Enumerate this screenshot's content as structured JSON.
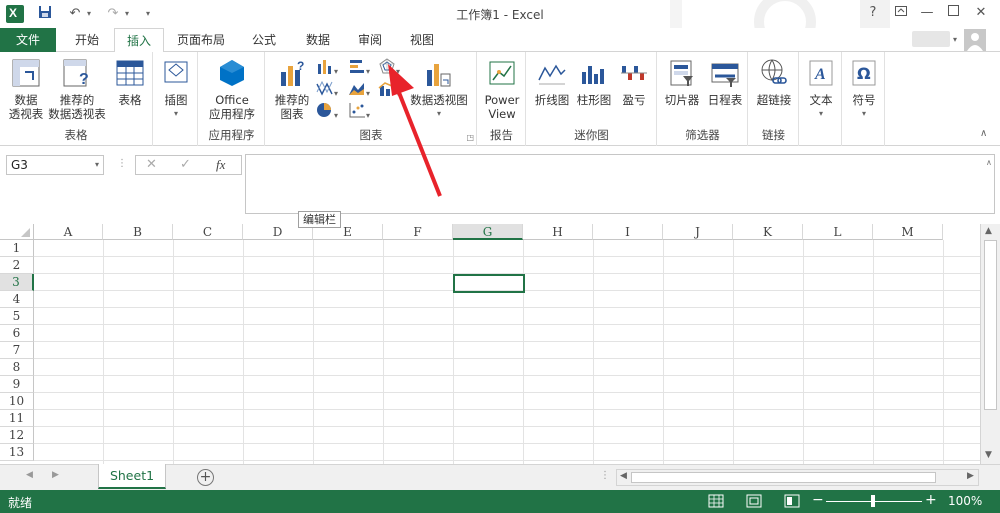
{
  "window": {
    "title": "工作簿1 - Excel",
    "help": "?",
    "user": "",
    "colors": {
      "accent": "#217346",
      "arrow": "#e8232b"
    }
  },
  "tabs": [
    {
      "label": "文件"
    },
    {
      "label": "开始"
    },
    {
      "label": "插入"
    },
    {
      "label": "页面布局"
    },
    {
      "label": "公式"
    },
    {
      "label": "数据"
    },
    {
      "label": "审阅"
    },
    {
      "label": "视图"
    }
  ],
  "ribbon": {
    "groups": {
      "tables": {
        "label": "表格",
        "pivot": [
          "数据",
          "透视表"
        ],
        "recommended_pivot": [
          "推荐的",
          "数据透视表"
        ],
        "table": "表格"
      },
      "illustrations": {
        "label": "插图"
      },
      "apps": {
        "label": "应用程序",
        "office": [
          "Office",
          "应用程序"
        ]
      },
      "charts": {
        "label": "图表",
        "recommended": [
          "推荐的",
          "图表"
        ],
        "pivot_chart": "数据透视图"
      },
      "reports": {
        "label": "报告",
        "powerview": [
          "Power",
          "View"
        ]
      },
      "sparklines": {
        "label": "迷你图",
        "line": "折线图",
        "column": "柱形图",
        "winloss": "盈亏"
      },
      "filters": {
        "label": "筛选器",
        "slicer": "切片器",
        "timeline": "日程表"
      },
      "links": {
        "label": "链接",
        "hyperlink": "超链接"
      },
      "text": {
        "label": "文本"
      },
      "symbols": {
        "label": "符号"
      }
    }
  },
  "formula_bar": {
    "name_box": "G3",
    "fx": "fx",
    "tooltip": "编辑栏",
    "value": ""
  },
  "grid": {
    "columns": [
      "A",
      "B",
      "C",
      "D",
      "E",
      "F",
      "G",
      "H",
      "I",
      "J",
      "K",
      "L",
      "M"
    ],
    "rows": [
      "1",
      "2",
      "3",
      "4",
      "5",
      "6",
      "7",
      "8",
      "9",
      "10",
      "11",
      "12",
      "13"
    ],
    "selected_column": "G",
    "selected_row": "3"
  },
  "sheets": [
    {
      "name": "Sheet1",
      "active": true
    }
  ],
  "status": {
    "ready": "就绪",
    "zoom": "100%"
  }
}
